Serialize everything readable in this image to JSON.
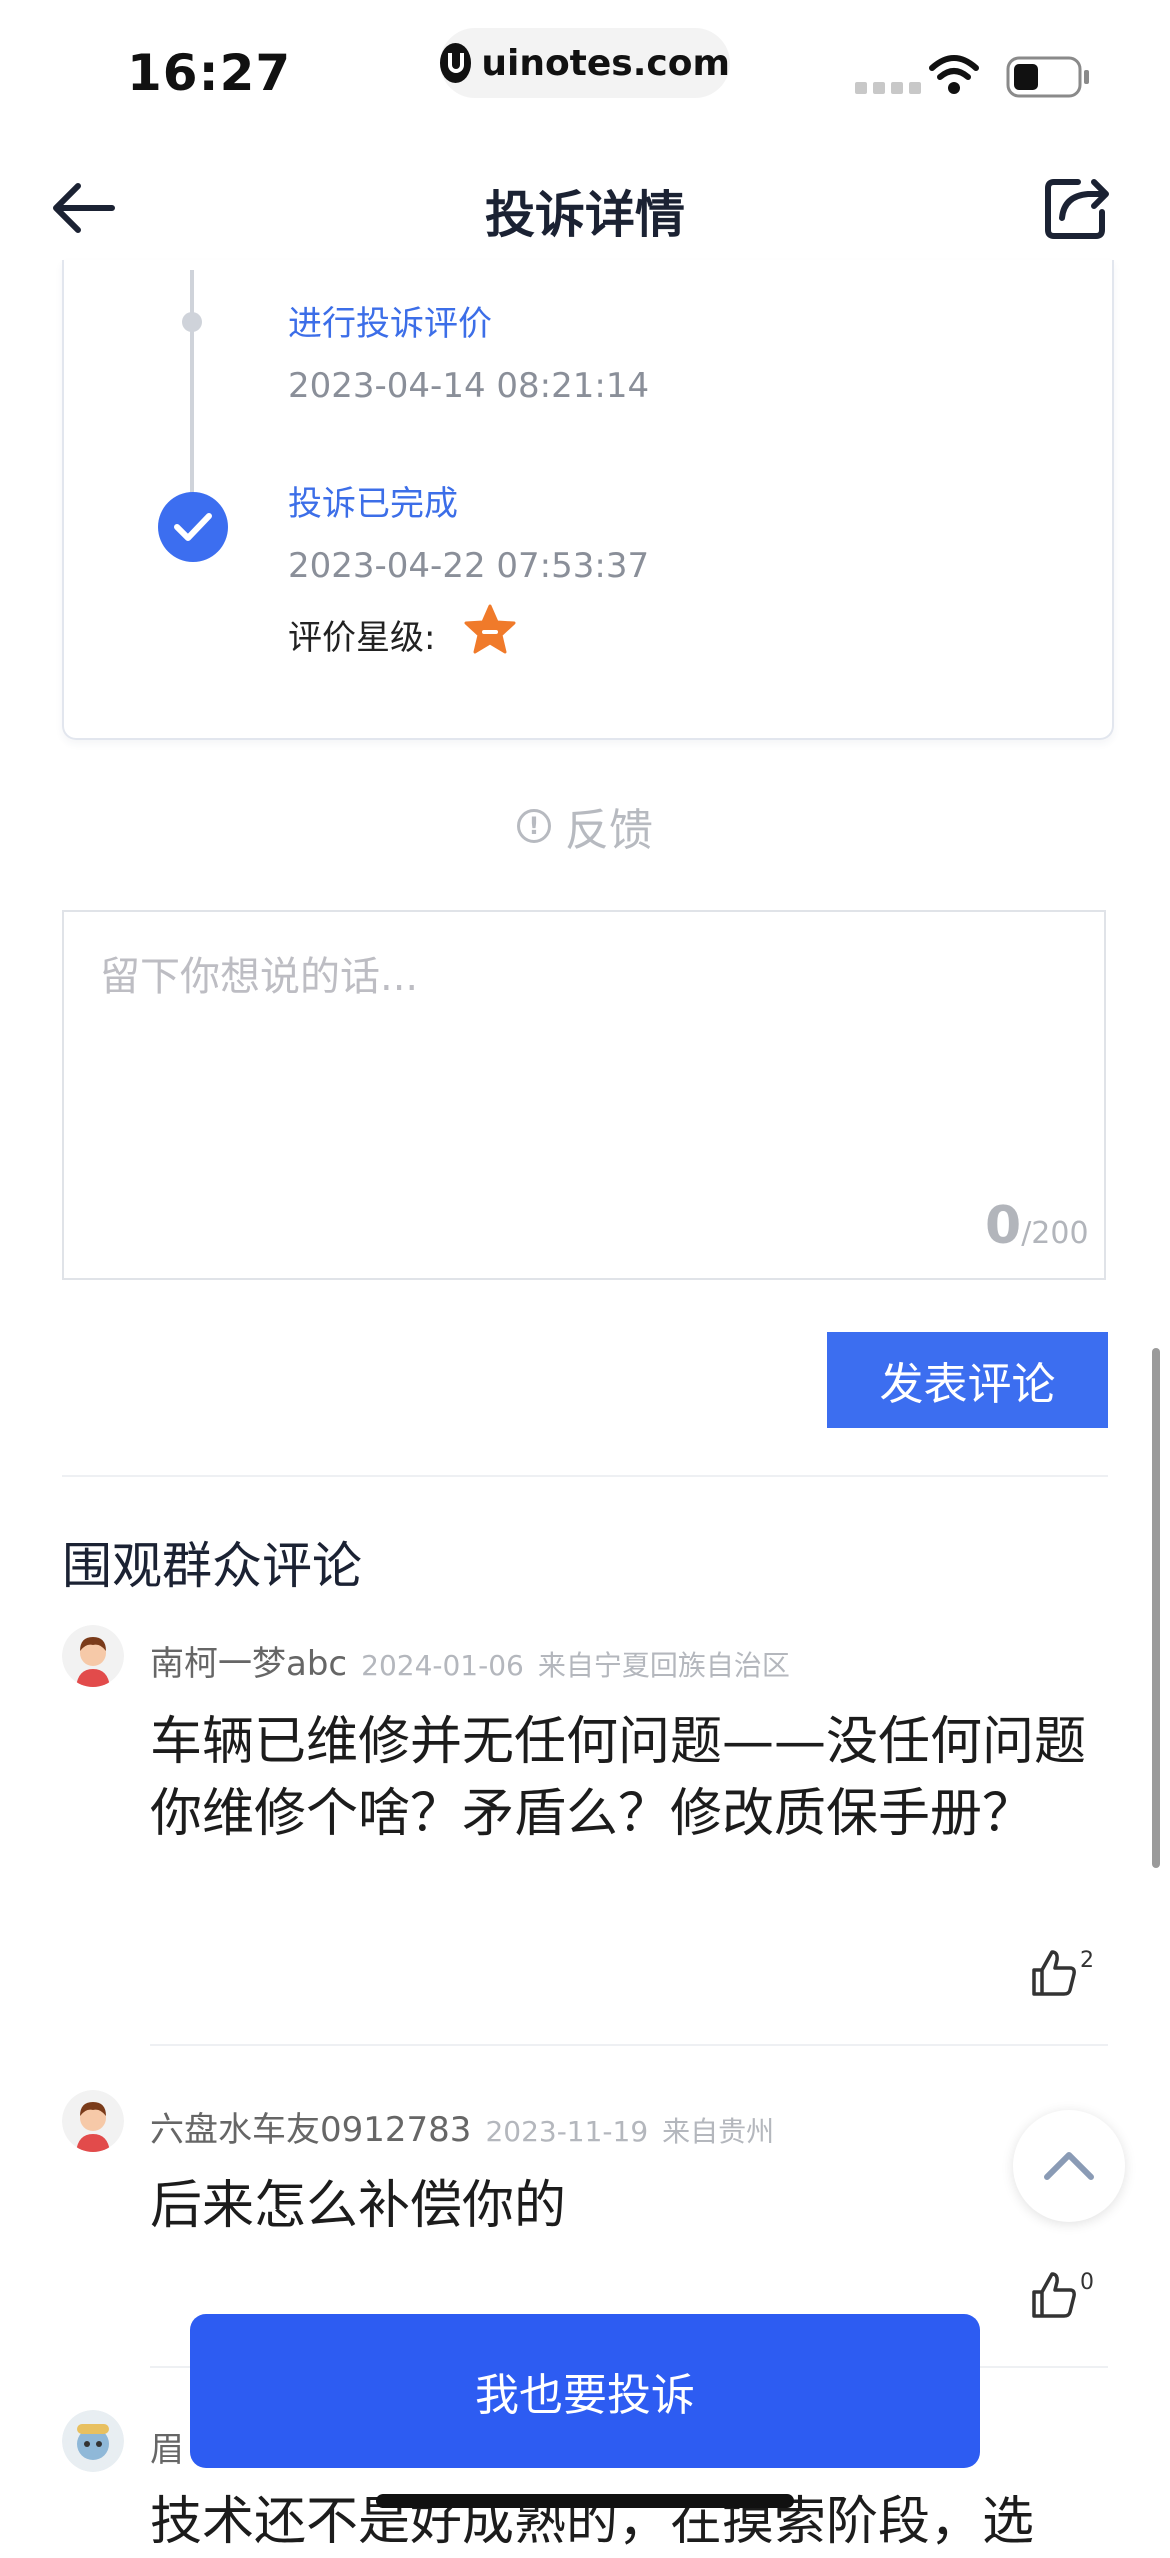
{
  "status_bar": {
    "time": "16:27",
    "url": "uinotes.com"
  },
  "nav": {
    "title": "投诉详情"
  },
  "timeline": [
    {
      "title": "进行投诉评价",
      "time": "2023-04-14 08:21:14"
    },
    {
      "title": "投诉已完成",
      "time": "2023-04-22 07:53:37",
      "rating_label": "评价星级:"
    }
  ],
  "feedback": {
    "label": "反馈"
  },
  "comment_box": {
    "placeholder": "留下你想说的话...",
    "count": "0",
    "max": "/200",
    "submit_label": "发表评论"
  },
  "comments_section": {
    "title": "围观群众评论"
  },
  "comments": [
    {
      "user": "南柯一梦abc",
      "date": "2024-01-06",
      "location": "来自宁夏回族自治区",
      "text": "车辆已维修并无任何问题——没任何问题你维修个啥？矛盾么？修改质保手册？",
      "likes": "2"
    },
    {
      "user": "六盘水车友0912783",
      "date": "2023-11-19",
      "location": "来自贵州",
      "text": "后来怎么补偿你的",
      "likes": "0"
    },
    {
      "user": "眉",
      "text": "技术还不是好成熟的，在摸索阶段，选"
    }
  ],
  "cta": {
    "label": "我也要投诉"
  },
  "colors": {
    "accent": "#3c6ef0",
    "cta": "#2d5cf2",
    "star": "#f07a2a"
  }
}
